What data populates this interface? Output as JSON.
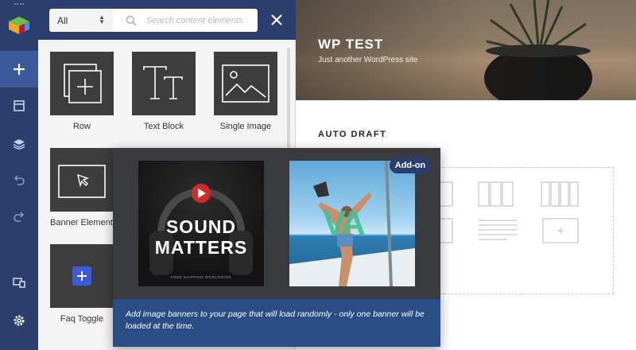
{
  "toolbar": {
    "items": [
      {
        "name": "add-element"
      },
      {
        "name": "templates"
      },
      {
        "name": "layers"
      },
      {
        "name": "undo"
      },
      {
        "name": "redo"
      },
      {
        "name": "responsive"
      },
      {
        "name": "settings"
      }
    ]
  },
  "panel": {
    "filter_selected": "All",
    "search_placeholder": "Search content elements",
    "elements": [
      {
        "label": "Row",
        "icon": "row-icon"
      },
      {
        "label": "Text Block",
        "icon": "text-block-icon"
      },
      {
        "label": "Single Image",
        "icon": "single-image-icon"
      },
      {
        "label": "Banner Element",
        "icon": "banner-element-icon"
      },
      {
        "label": "Faq Toggle",
        "icon": "faq-toggle-icon"
      }
    ]
  },
  "preview": {
    "site_title": "WP TEST",
    "site_tagline": "Just another WordPress site",
    "page_title": "AUTO DRAFT"
  },
  "popup": {
    "badge": "Add-on",
    "banner1_line1": "SOUND",
    "banner1_line2": "MATTERS",
    "banner1_small": "FREE SHIPPING WORLDWIDE",
    "banner2_logo": "VA",
    "description": "Add image banners to your page that will load randomly - only one banner will be loaded at the time."
  },
  "colors": {
    "toolbar_bg": "#2c3e6e",
    "accent": "#3b5998",
    "popup_desc_bg": "#2b4d86",
    "tile_bg": "#3d3d3d"
  }
}
